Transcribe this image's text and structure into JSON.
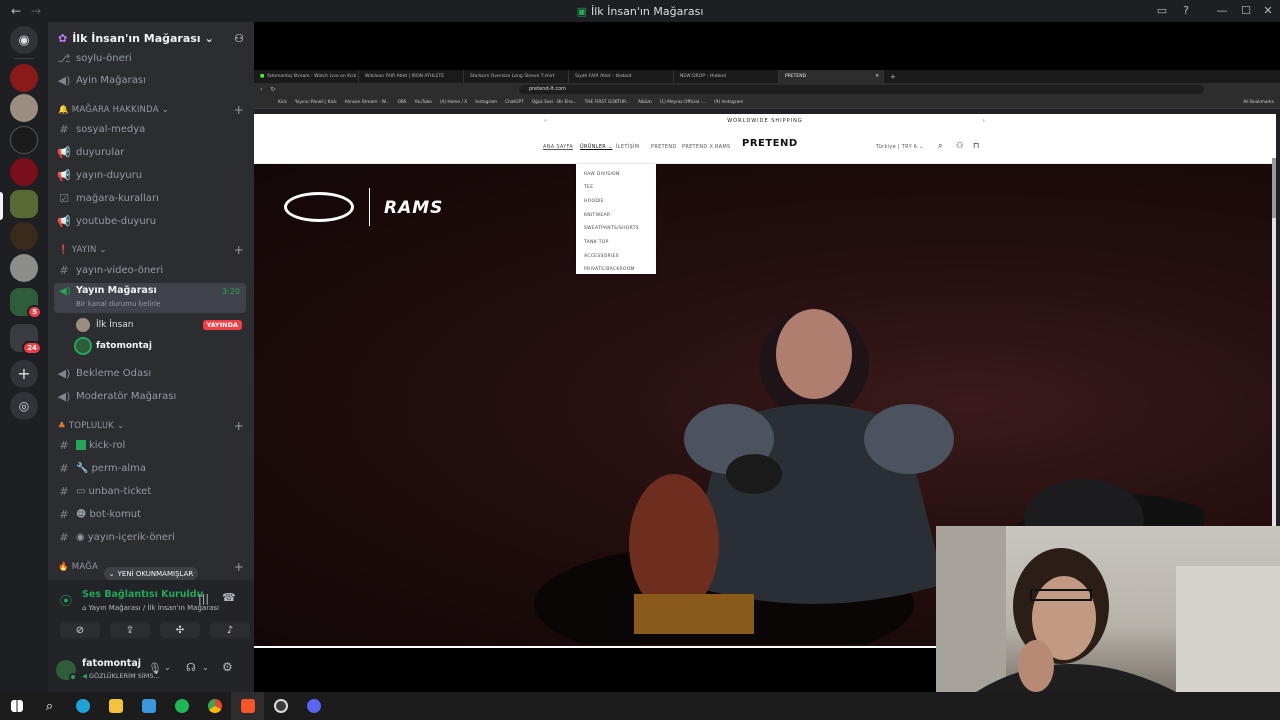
{
  "window": {
    "title": "İlk İnsan'ın Mağarası"
  },
  "server": {
    "name": "İlk İnsan'ın Mağarası"
  },
  "rail_badges": [
    "5",
    "24"
  ],
  "channels": {
    "top": [
      {
        "name": "soylu-öneri"
      },
      {
        "name": "Ayin Mağarası"
      }
    ],
    "cat_magara": "MAĞARA HAKKINDA",
    "magara": [
      {
        "name": "sosyal-medya"
      },
      {
        "name": "duyurular"
      },
      {
        "name": "yayın-duyuru"
      },
      {
        "name": "mağara-kuralları"
      },
      {
        "name": "youtube-duyuru"
      }
    ],
    "cat_yayin": "YAYIN",
    "yayin_text": "yayın-video-öneri",
    "voice_channel": "Yayın Mağarası",
    "voice_time": "3:20",
    "voice_status": "Bir kanal durumu belirle",
    "voice_users": [
      {
        "name": "İlk İnsan",
        "badge": "YAYINDA"
      },
      {
        "name": "fatomontaj"
      }
    ],
    "yayin_more": [
      {
        "name": "Bekleme Odası"
      },
      {
        "name": "Moderatör Mağarası"
      }
    ],
    "cat_topluluk": "TOPLULUK",
    "topluluk": [
      {
        "name": "kick-rol"
      },
      {
        "name": "perm-alma"
      },
      {
        "name": "unban-ticket"
      },
      {
        "name": "bot-komut"
      },
      {
        "name": "yayın-içerik-öneri"
      }
    ],
    "cat_partial": "MAĞA"
  },
  "new_unreads": "YENİ OKUNMAMIŞLAR",
  "voice_panel": {
    "status": "Ses Bağlantısı Kuruldu",
    "location": "Yayın Mağarası / İlk İnsan'ın Mağarası"
  },
  "user": {
    "name": "fatomontaj",
    "status": "GÖZLÜKLERİM SİMS..."
  },
  "browser": {
    "tabs": [
      "fatomontaj Stream - Watch Live on Kick",
      "Wikiloon FAIR Atlet | IRON ATHLETE",
      "Starborn Oversize Long Sleeve T-shirt",
      "Siyah FAIR Atlet – thebod",
      "NEW DROP – thebod",
      "PRETEND"
    ],
    "url": "pretend-lt.com",
    "bookmarks": [
      "Kick",
      "Yayıncı Paneli | Kick",
      "Alınsan Stream - W...",
      "OBS",
      "YouTube",
      "(4) Home / X",
      "Instagram",
      "ChatGPT",
      "Oğuz Sezi - Bir Eha...",
      "THE FIRST GOKTUR...",
      "Albüm",
      "(1) Meyraz Official -...",
      "(9) Instagram"
    ],
    "all_bookmarks": "All Bookmarks"
  },
  "site": {
    "shipping": "WORLDWIDE SHIPPING",
    "nav": [
      "ANA SAYFA",
      "ÜRÜNLER",
      "İLETİŞİM",
      "PRETEND",
      "PRETEND X RAMS"
    ],
    "logo": "PRETEND",
    "locale": "Türkiye | TRY ₺",
    "dropdown": [
      "RAW DIVISION",
      "TEE",
      "HOODIE",
      "KNITWEAR",
      "SWEATPANTS/SHORTS",
      "TANK TOP",
      "ACCESSORIES",
      "PRIVATE/BACKROOM"
    ],
    "hero_text": "RAMS"
  },
  "colors": {
    "discord_bg": "#1e1f22",
    "sidebar": "#2b2d31",
    "green": "#23a55a",
    "red": "#f23f43"
  }
}
